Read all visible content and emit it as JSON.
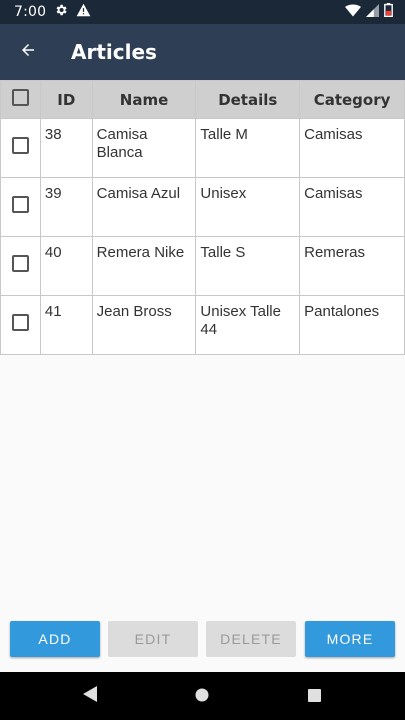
{
  "status_bar": {
    "time": "7:00",
    "icons": [
      "gear-icon",
      "warning-icon",
      "wifi-icon",
      "signal-icon",
      "battery-icon"
    ]
  },
  "app_bar": {
    "title": "Articles",
    "back_icon": "arrow-back-icon"
  },
  "table": {
    "headers": [
      "ID",
      "Name",
      "Details",
      "Category"
    ],
    "rows": [
      {
        "id": "38",
        "name": "Camisa Blanca",
        "details": "Talle M",
        "category": "Camisas"
      },
      {
        "id": "39",
        "name": "Camisa Azul",
        "details": "Unisex",
        "category": "Camisas"
      },
      {
        "id": "40",
        "name": "Remera Nike",
        "details": "Talle S",
        "category": "Remeras"
      },
      {
        "id": "41",
        "name": "Jean Bross",
        "details": "Unisex Talle 44",
        "category": "Pantalones"
      }
    ]
  },
  "actions": {
    "add": "ADD",
    "edit": "EDIT",
    "delete": "DELETE",
    "more": "MORE"
  },
  "colors": {
    "status_bar": "#1b2838",
    "app_bar": "#2e3f55",
    "primary_button": "#3399dd",
    "disabled_button": "#dcdcdc",
    "header_cell": "#cfcfcf"
  }
}
